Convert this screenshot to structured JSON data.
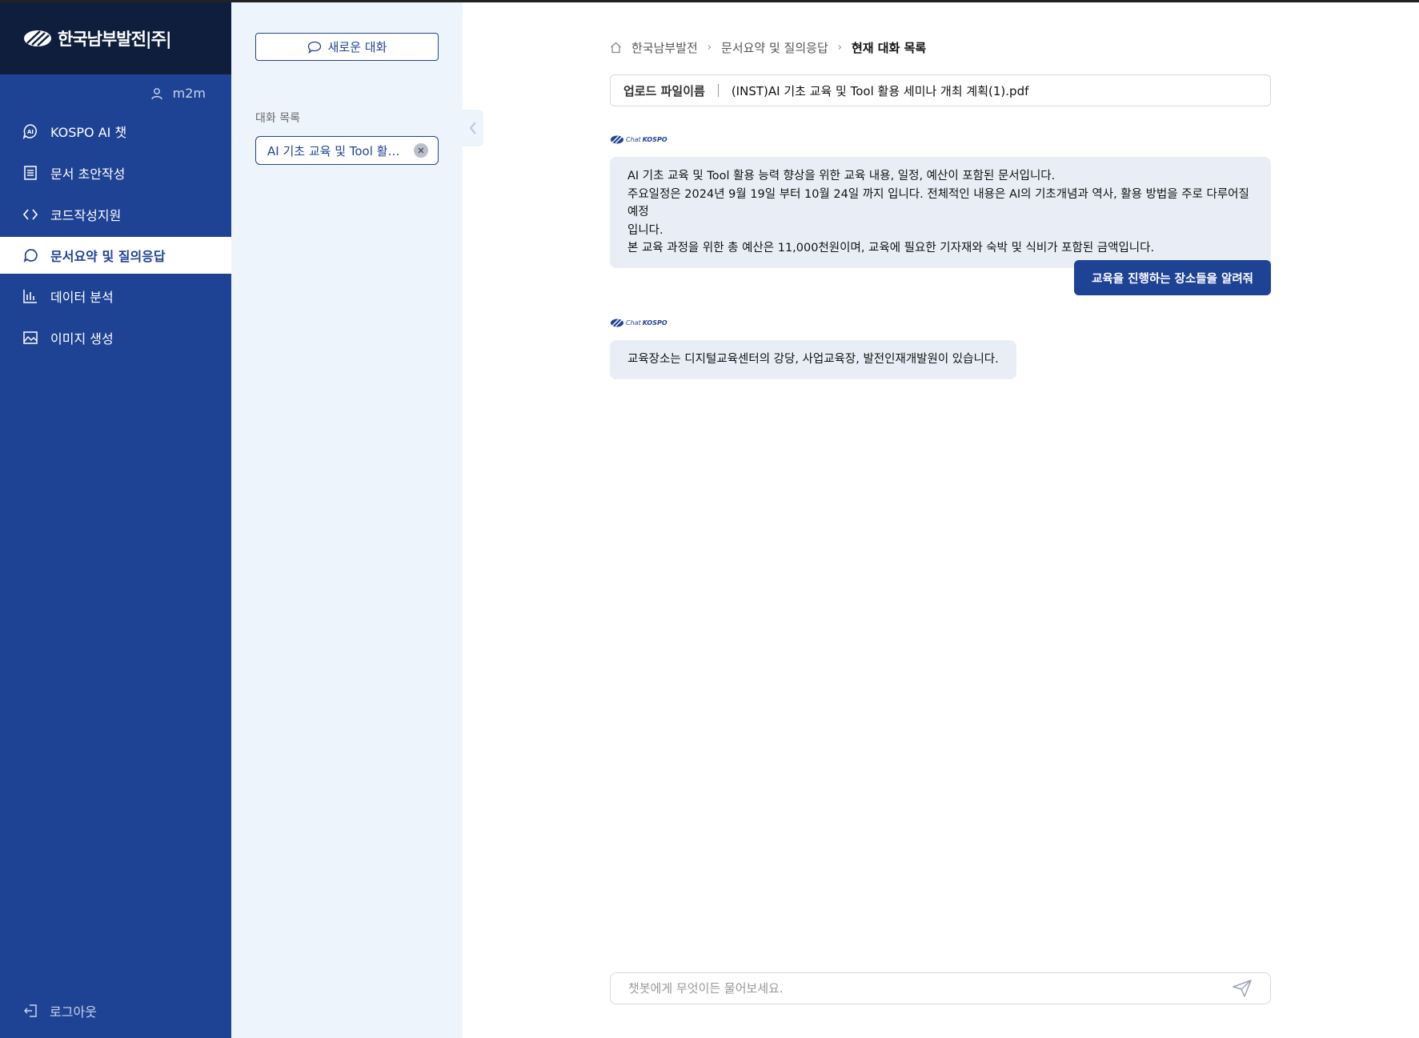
{
  "brand": {
    "logo_text": "한국남부발전|주|"
  },
  "user": {
    "name": "m2m"
  },
  "nav": {
    "items": [
      {
        "label": "KOSPO AI 챗"
      },
      {
        "label": "문서 초안작성"
      },
      {
        "label": "코드작성지원"
      },
      {
        "label": "문서요약 및 질의응답"
      },
      {
        "label": "데이터 분석"
      },
      {
        "label": "이미지 생성"
      }
    ],
    "logout": "로그아웃"
  },
  "conversations": {
    "new_chat": "새로운 대화",
    "title": "대화 목록",
    "items": [
      {
        "label": "AI 기초 교육 및 Tool 활용 세미나"
      }
    ]
  },
  "breadcrumb": {
    "home": "한국남부발전",
    "section": "문서요약 및 질의응답",
    "current": "현재 대화 목록"
  },
  "file": {
    "label": "업로드 파일이름",
    "name": "(INST)AI 기초 교육 및 Tool 활용 세미나 개최 계획(1).pdf"
  },
  "bot": {
    "logo_chat": "Chat",
    "logo_kospo": "KOSPO"
  },
  "messages": [
    {
      "role": "bot",
      "lines": [
        "AI 기초 교육 및 Tool 활용 능력 향상을 위한 교육 내용, 일정, 예산이 포함된 문서입니다.",
        "주요일정은 2024년 9월 19일 부터 10월 24일 까지 입니다. 전체적인 내용은 AI의 기초개념과 역사, 활용 방법을 주로 다루어질 예정",
        "입니다.",
        "본 교육 과정을 위한 총 예산은 11,000천원이며, 교육에 필요한 기자재와 숙박 및 식비가 포함된 금액입니다."
      ]
    },
    {
      "role": "user",
      "text": "교육을 진행하는 장소들을 알려줘"
    },
    {
      "role": "bot",
      "lines": [
        "교육장소는 디지털교육센터의 강당, 사업교육장, 발전인재개발원이 있습니다."
      ]
    }
  ],
  "input": {
    "placeholder": "챗봇에게 무엇이든 물어보세요."
  },
  "colors": {
    "primary": "#1f4394",
    "logo_bg": "#0f1e3d",
    "panel_bg": "#eef4fc",
    "bubble_bg": "#e9eef6"
  }
}
